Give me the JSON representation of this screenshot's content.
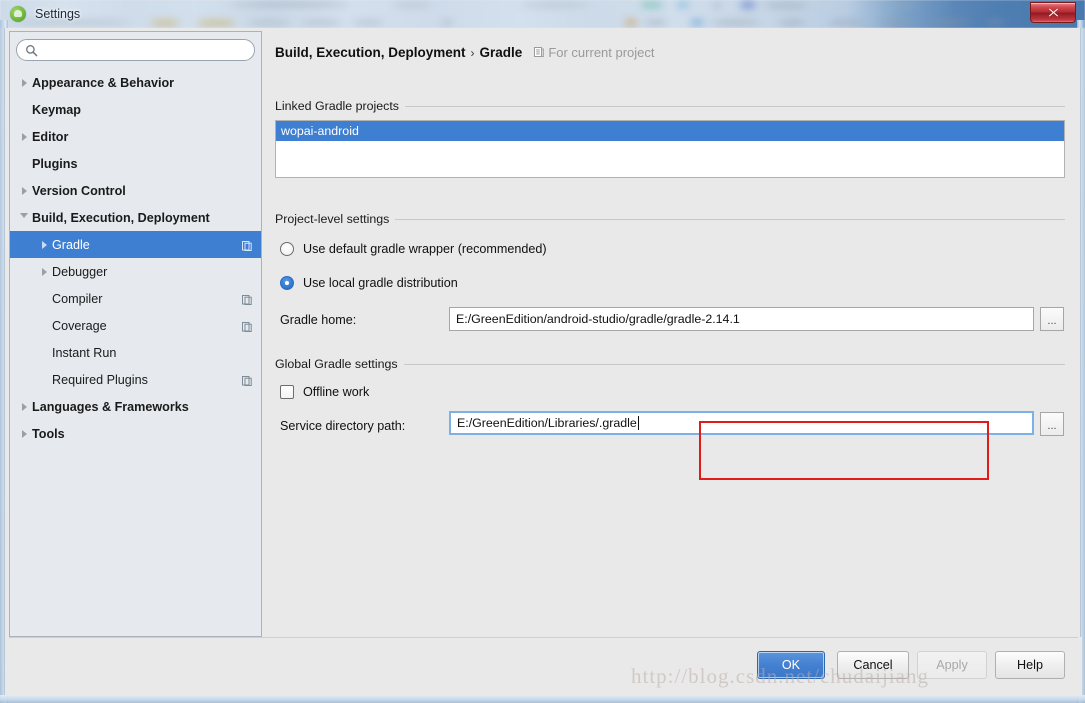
{
  "window": {
    "title": "Settings",
    "app_icon": "android-robot-icon",
    "close_label": "✕"
  },
  "search": {
    "value": "",
    "placeholder": "",
    "icon": "search-icon"
  },
  "sidebar": {
    "items": [
      {
        "label": "Appearance & Behavior",
        "level": 0,
        "bold": true,
        "arrow": "collapsed",
        "badge": false,
        "selected": false
      },
      {
        "label": "Keymap",
        "level": 0,
        "bold": true,
        "arrow": "none",
        "badge": false,
        "selected": false
      },
      {
        "label": "Editor",
        "level": 0,
        "bold": true,
        "arrow": "collapsed",
        "badge": false,
        "selected": false
      },
      {
        "label": "Plugins",
        "level": 0,
        "bold": true,
        "arrow": "none",
        "badge": false,
        "selected": false
      },
      {
        "label": "Version Control",
        "level": 0,
        "bold": true,
        "arrow": "collapsed",
        "badge": false,
        "selected": false
      },
      {
        "label": "Build, Execution, Deployment",
        "level": 0,
        "bold": true,
        "arrow": "expanded",
        "badge": false,
        "selected": false
      },
      {
        "label": "Gradle",
        "level": 1,
        "bold": false,
        "arrow": "collapsed",
        "badge": true,
        "selected": true
      },
      {
        "label": "Debugger",
        "level": 1,
        "bold": false,
        "arrow": "collapsed",
        "badge": false,
        "selected": false
      },
      {
        "label": "Compiler",
        "level": 1,
        "bold": false,
        "arrow": "none",
        "badge": true,
        "selected": false
      },
      {
        "label": "Coverage",
        "level": 1,
        "bold": false,
        "arrow": "none",
        "badge": true,
        "selected": false
      },
      {
        "label": "Instant Run",
        "level": 1,
        "bold": false,
        "arrow": "none",
        "badge": false,
        "selected": false
      },
      {
        "label": "Required Plugins",
        "level": 1,
        "bold": false,
        "arrow": "none",
        "badge": true,
        "selected": false
      },
      {
        "label": "Languages & Frameworks",
        "level": 0,
        "bold": true,
        "arrow": "collapsed",
        "badge": false,
        "selected": false
      },
      {
        "label": "Tools",
        "level": 0,
        "bold": true,
        "arrow": "collapsed",
        "badge": false,
        "selected": false
      }
    ]
  },
  "content": {
    "breadcrumb_parent": "Build, Execution, Deployment",
    "breadcrumb_sep": "›",
    "breadcrumb_current": "Gradle",
    "scope_icon": "module-scope-icon",
    "scope_label": "For current project",
    "linked_projects": {
      "group_title": "Linked Gradle projects",
      "items": [
        {
          "label": "wopai-android",
          "selected": true
        }
      ]
    },
    "project_level": {
      "group_title": "Project-level settings",
      "radios": [
        {
          "label": "Use default gradle wrapper (recommended)",
          "checked": false
        },
        {
          "label": "Use local gradle distribution",
          "checked": true
        }
      ],
      "gradle_home": {
        "label": "Gradle home:",
        "value": "E:/GreenEdition/android-studio/gradle/gradle-2.14.1",
        "browse_label": "..."
      }
    },
    "global_settings": {
      "group_title": "Global Gradle settings",
      "offline_work": {
        "label": "Offline work",
        "checked": false
      },
      "service_directory": {
        "label": "Service directory path:",
        "value": "E:/GreenEdition/Libraries/.gradle",
        "browse_label": "...",
        "focused": true
      }
    }
  },
  "buttons": {
    "ok": "OK",
    "cancel": "Cancel",
    "apply": "Apply",
    "help": "Help"
  },
  "watermark": "http://blog.csdn.net/chudaijiang",
  "colors": {
    "selection_blue": "#3f7fd2",
    "default_button_blue": "#4480d1",
    "highlight_red": "#e01b19",
    "pane_bg": "#e9e9e9",
    "sidebar_bg": "#e6eaee"
  }
}
